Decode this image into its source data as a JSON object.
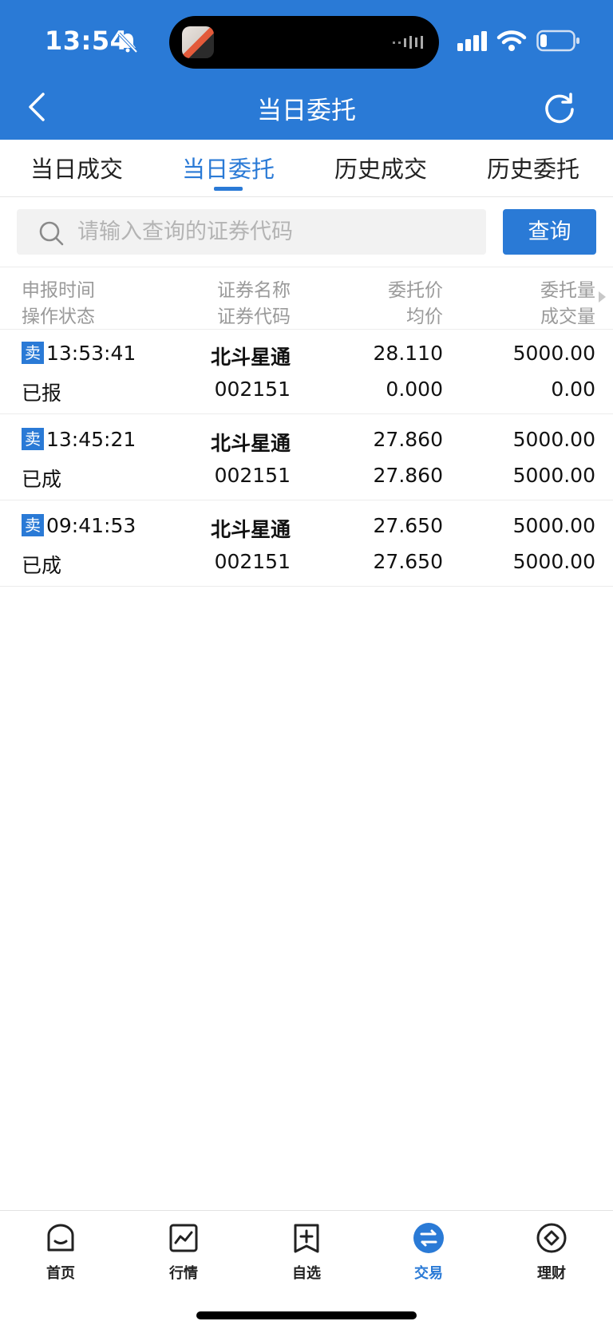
{
  "status_bar": {
    "time": "13:54"
  },
  "nav": {
    "title": "当日委托"
  },
  "tabs": [
    {
      "label": "当日成交",
      "active": false
    },
    {
      "label": "当日委托",
      "active": true
    },
    {
      "label": "历史成交",
      "active": false
    },
    {
      "label": "历史委托",
      "active": false
    }
  ],
  "search": {
    "placeholder": "请输入查询的证券代码",
    "value": "",
    "button_label": "查询"
  },
  "columns": {
    "c1_top": "申报时间",
    "c1_bottom": "操作状态",
    "c2_top": "证券名称",
    "c2_bottom": "证券代码",
    "c3_top": "委托价",
    "c3_bottom": "均价",
    "c4_top": "委托量",
    "c4_bottom": "成交量"
  },
  "orders": [
    {
      "side": "卖",
      "time": "13:53:41",
      "status": "已报",
      "name": "北斗星通",
      "code": "002151",
      "price": "28.110",
      "avg_price": "0.000",
      "qty": "5000.00",
      "filled": "0.00"
    },
    {
      "side": "卖",
      "time": "13:45:21",
      "status": "已成",
      "name": "北斗星通",
      "code": "002151",
      "price": "27.860",
      "avg_price": "27.860",
      "qty": "5000.00",
      "filled": "5000.00"
    },
    {
      "side": "卖",
      "time": "09:41:53",
      "status": "已成",
      "name": "北斗星通",
      "code": "002151",
      "price": "27.650",
      "avg_price": "27.650",
      "qty": "5000.00",
      "filled": "5000.00"
    }
  ],
  "tabbar": [
    {
      "label": "首页",
      "icon": "home-icon",
      "active": false
    },
    {
      "label": "行情",
      "icon": "chart-icon",
      "active": false
    },
    {
      "label": "自选",
      "icon": "watchlist-add-icon",
      "active": false
    },
    {
      "label": "交易",
      "icon": "trade-exchange-icon",
      "active": true
    },
    {
      "label": "理财",
      "icon": "wealth-icon",
      "active": false
    }
  ],
  "colors": {
    "brand_blue": "#2a7ad6",
    "muted_text": "#9a9a9a"
  }
}
